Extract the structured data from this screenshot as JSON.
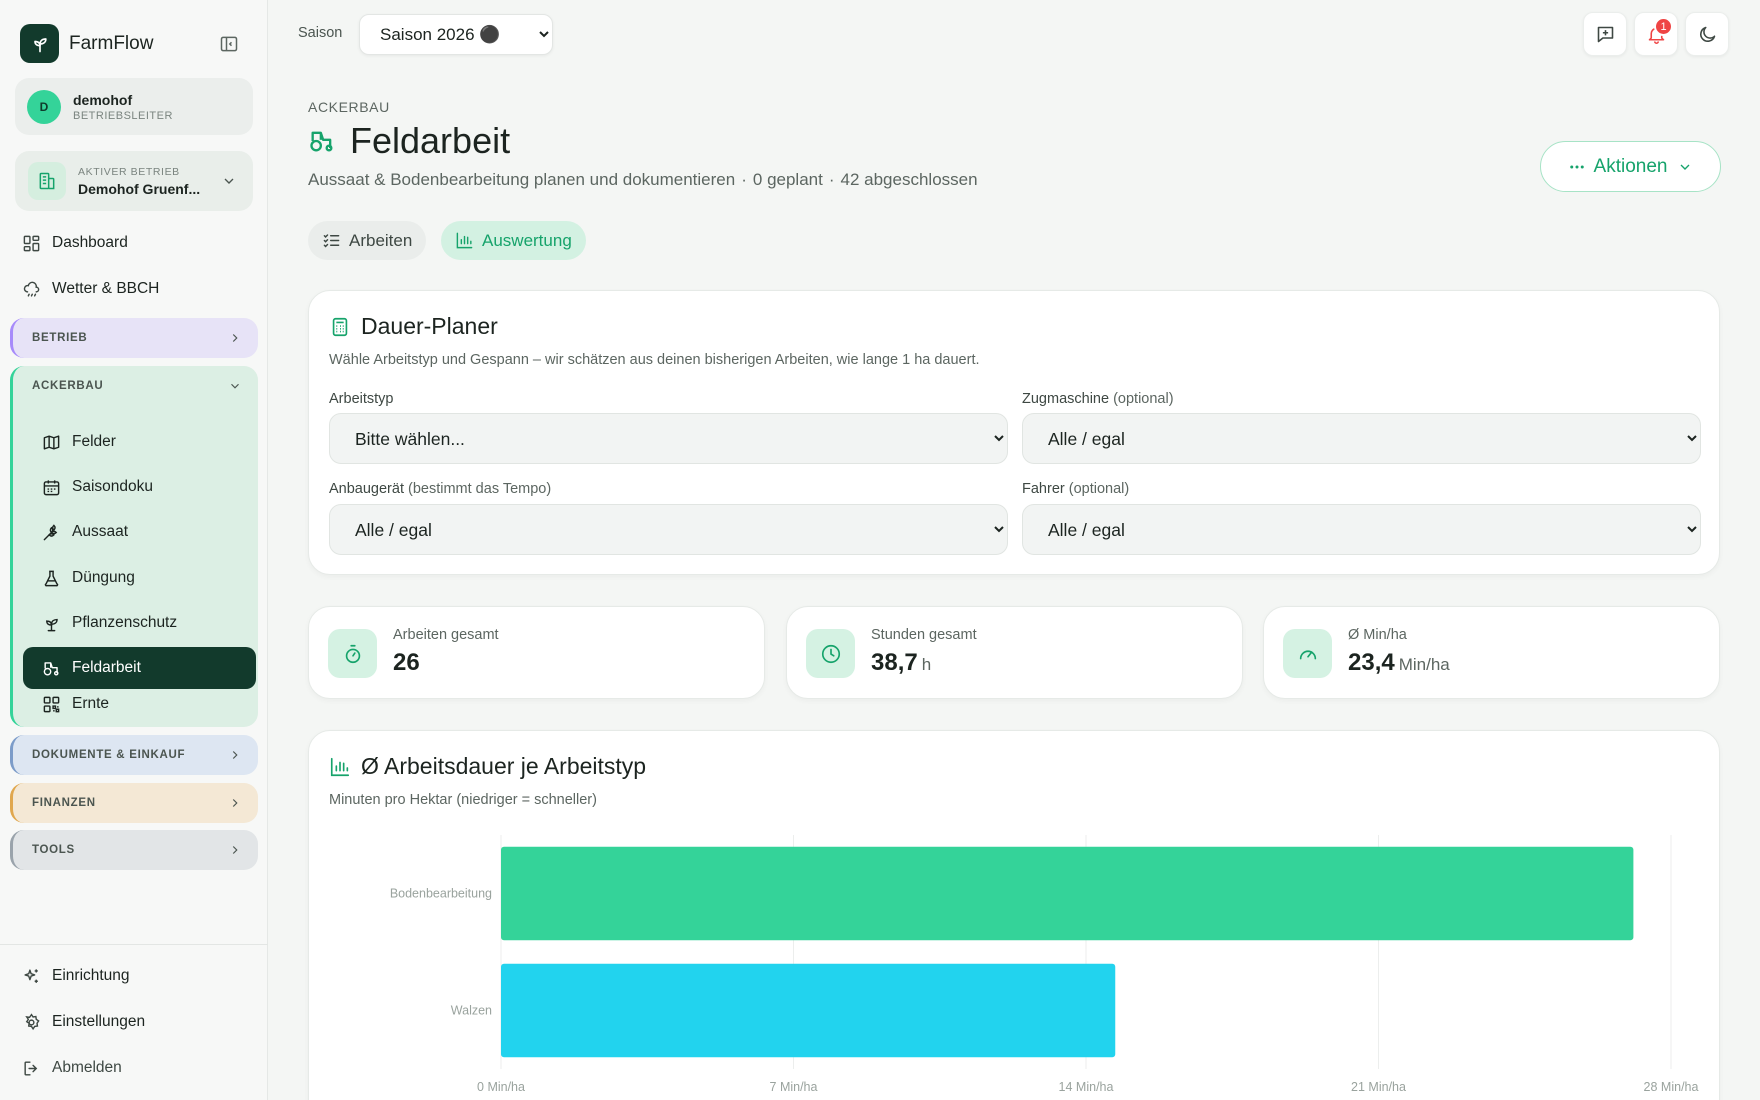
{
  "app": {
    "name": "FarmFlow"
  },
  "user": {
    "initial": "D",
    "name": "demohof",
    "role": "BETRIEBSLEITER"
  },
  "betrieb": {
    "label": "AKTIVER BETRIEB",
    "name": "Demohof Gruenf..."
  },
  "nav": {
    "dashboard": "Dashboard",
    "wetter": "Wetter & BBCH"
  },
  "groups": {
    "betrieb": "BETRIEB",
    "ackerbau": "ACKERBAU",
    "dokumente": "DOKUMENTE & EINKAUF",
    "finanzen": "FINANZEN",
    "tools": "TOOLS"
  },
  "ackerbau_items": {
    "felder": "Felder",
    "saisondoku": "Saisondoku",
    "aussaat": "Aussaat",
    "duengung": "Düngung",
    "pflanzenschutz": "Pflanzenschutz",
    "feldarbeit": "Feldarbeit",
    "ernte": "Ernte"
  },
  "footer_nav": {
    "einrichtung": "Einrichtung",
    "einstellungen": "Einstellungen",
    "abmelden": "Abmelden"
  },
  "topbar": {
    "season_label": "Saison",
    "season_value": "Saison 2026 ⚫",
    "notification_count": "1"
  },
  "header": {
    "eyebrow": "ACKERBAU",
    "title": "Feldarbeit",
    "subtitle_main": "Aussaat & Bodenbearbeitung planen und dokumentieren",
    "subtitle_planned": "0 geplant",
    "subtitle_done": "42 abgeschlossen",
    "actions_label": "Aktionen"
  },
  "tabs": {
    "arbeiten": "Arbeiten",
    "auswertung": "Auswertung"
  },
  "planer": {
    "title": "Dauer-Planer",
    "subtitle": "Wähle Arbeitstyp und Gespann – wir schätzen aus deinen bisherigen Arbeiten, wie lange 1 ha dauert.",
    "arbeitstyp_label": "Arbeitstyp",
    "arbeitstyp_value": "Bitte wählen...",
    "zugmaschine_label": "Zugmaschine",
    "zugmaschine_hint": "(optional)",
    "zugmaschine_value": "Alle / egal",
    "anbaugeraet_label": "Anbaugerät",
    "anbaugeraet_hint": "(bestimmt das Tempo)",
    "anbaugeraet_value": "Alle / egal",
    "fahrer_label": "Fahrer",
    "fahrer_hint": "(optional)",
    "fahrer_value": "Alle / egal"
  },
  "stats": {
    "arbeiten": {
      "label": "Arbeiten gesamt",
      "value": "26",
      "unit": ""
    },
    "stunden": {
      "label": "Stunden gesamt",
      "value": "38,7",
      "unit": "h"
    },
    "minha": {
      "label": "Ø Min/ha",
      "value": "23,4",
      "unit": "Min/ha"
    }
  },
  "chart_card": {
    "title": "Ø Arbeitsdauer je Arbeitstyp",
    "subtitle": "Minuten pro Hektar (niedriger = schneller)"
  },
  "colors": {
    "accent": "#16a36b",
    "dark": "#123a2c",
    "bar1": "#34d399",
    "bar2": "#22d3ee"
  },
  "chart_data": {
    "type": "bar",
    "orientation": "horizontal",
    "title": "Ø Arbeitsdauer je Arbeitstyp",
    "subtitle": "Minuten pro Hektar (niedriger = schneller)",
    "categories": [
      "Bodenbearbeitung",
      "Walzen"
    ],
    "values": [
      27.1,
      14.7
    ],
    "colors": [
      "#34d399",
      "#22d3ee"
    ],
    "x_ticks": [
      0,
      7,
      14,
      21,
      28
    ],
    "x_tick_labels": [
      "0 Min/ha",
      "7 Min/ha",
      "14 Min/ha",
      "21 Min/ha",
      "28 Min/ha"
    ],
    "xlim": [
      0,
      28
    ],
    "grid": true,
    "legend": "none"
  }
}
